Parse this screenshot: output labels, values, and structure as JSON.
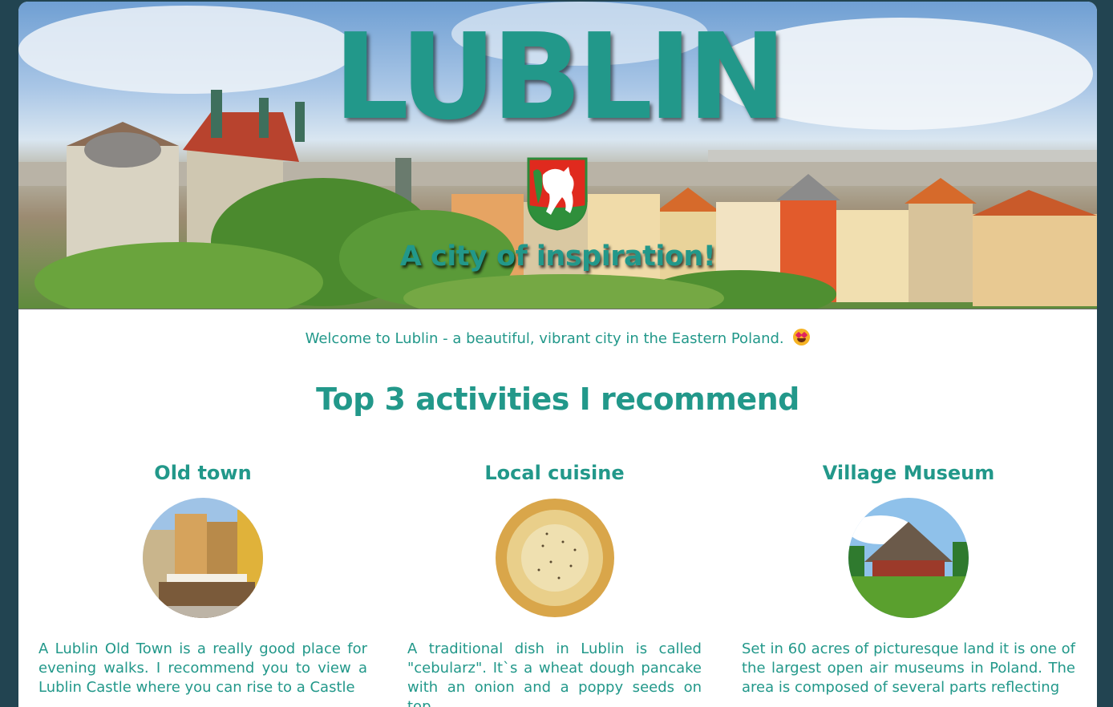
{
  "hero": {
    "title": "LUBLIN",
    "subtitle": "A city of inspiration!"
  },
  "intro": {
    "welcome": "Welcome to Lublin - a beautiful, vibrant city in the Eastern Poland.",
    "emoji_icon": "star-struck-emoji-icon"
  },
  "activities": {
    "heading": "Top 3 activities I recommend",
    "items": [
      {
        "title": "Old town",
        "image_icon": "old-town-street-image",
        "text": "A Lublin Old Town is a really good place for evening walks. I recommend you to view a Lublin Castle where you can rise to a Castle"
      },
      {
        "title": "Local cuisine",
        "image_icon": "cebularz-pancake-image",
        "text": "A traditional dish in Lublin is called \"cebularz\". It`s a wheat dough pancake with an onion and a poppy seeds on top."
      },
      {
        "title": "Village Museum",
        "image_icon": "village-museum-house-image",
        "text": "Set in 60 acres of picturesque land it is one of the largest open air museums in Poland. The area is composed of several parts reflecting"
      }
    ]
  },
  "colors": {
    "accent": "#22988a",
    "background": "#224451",
    "panel": "#ffffff"
  }
}
